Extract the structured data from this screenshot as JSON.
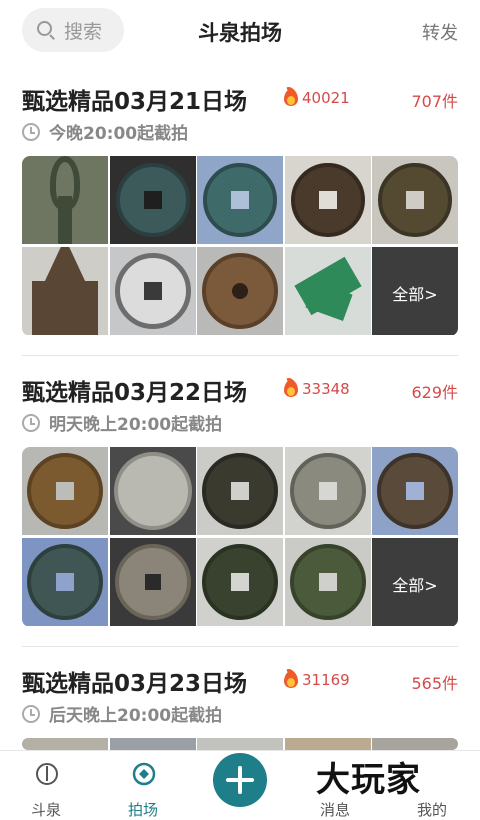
{
  "header": {
    "search_placeholder": "搜索",
    "title": "斗泉拍场",
    "share_label": "转发"
  },
  "sessions": [
    {
      "title": "甄选精品03月21日场",
      "hot": "40021",
      "count": "707件",
      "time": "今晚20:00起截拍"
    },
    {
      "title": "甄选精品03月22日场",
      "hot": "33348",
      "count": "629件",
      "time": "明天晚上20:00起截拍"
    },
    {
      "title": "甄选精品03月23日场",
      "hot": "31169",
      "count": "565件",
      "time": "后天晚上20:00起截拍"
    }
  ],
  "more_label": "全部>",
  "tabbar": {
    "tabs": [
      "斗泉",
      "拍场",
      "消息",
      "我的"
    ],
    "active_color": "#1e7e8a"
  },
  "watermark": "大玩家",
  "colors": {
    "accent": "#1e7e8a",
    "hot": "#d64a4a",
    "flame": "#ef5a2a"
  },
  "icons": [
    "search-icon",
    "fire-icon",
    "clock-icon",
    "add-icon",
    "home-icon",
    "auction-icon"
  ]
}
